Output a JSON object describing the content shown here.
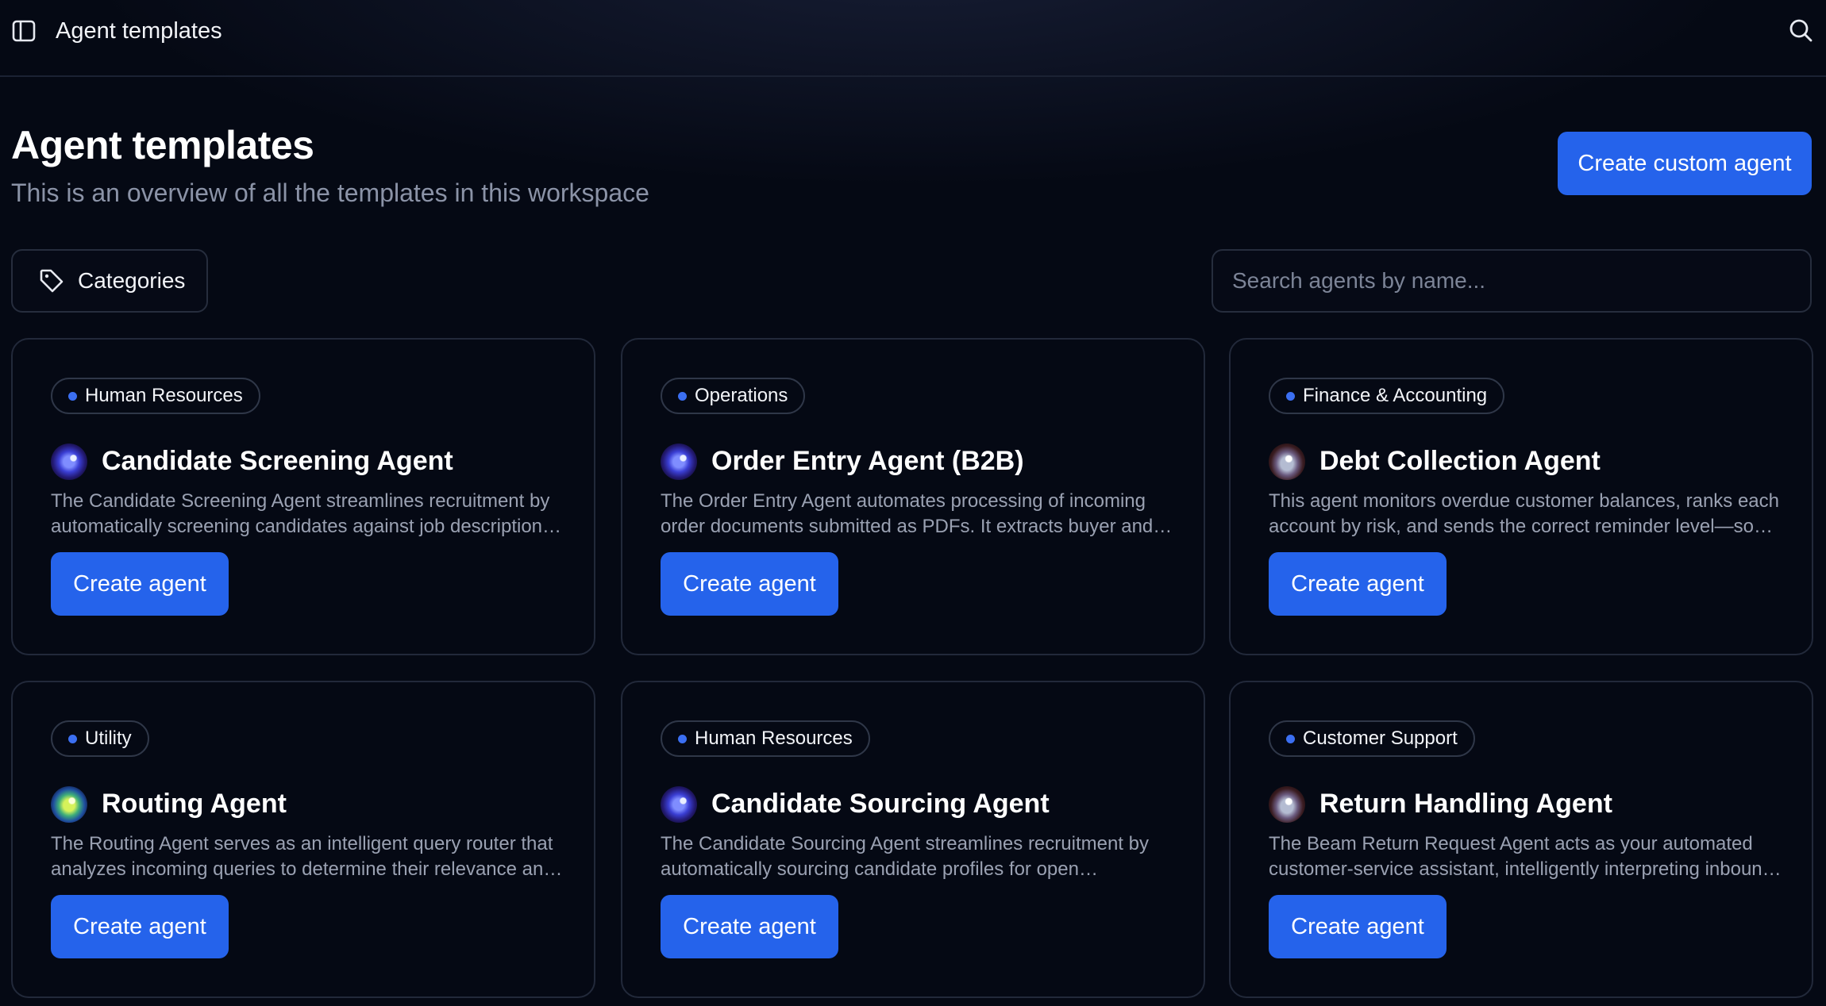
{
  "header": {
    "title": "Agent templates",
    "sidebar_toggle_icon": "sidebar-toggle-icon",
    "search_icon": "search-icon"
  },
  "page": {
    "title": "Agent templates",
    "subtitle": "This is an overview of all the templates in this workspace",
    "create_custom_label": "Create custom agent"
  },
  "filters": {
    "categories_label": "Categories",
    "categories_icon": "tag-icon",
    "search_placeholder": "Search agents by name..."
  },
  "colors": {
    "accent": "#2563eb",
    "background": "#050914",
    "pill_dot": "#3b6ff2"
  },
  "cards": [
    {
      "category": "Human Resources",
      "title": "Candidate Screening Agent",
      "description": "The Candidate Screening Agent streamlines recruitment by automatically screening candidates against job description…",
      "button": "Create agent",
      "icon": "blue-orb-icon"
    },
    {
      "category": "Operations",
      "title": "Order Entry Agent (B2B)",
      "description": "The Order Entry Agent automates processing of incoming order documents submitted as PDFs. It extracts buyer and…",
      "button": "Create agent",
      "icon": "blue-orb-icon"
    },
    {
      "category": "Finance & Accounting",
      "title": "Debt Collection Agent",
      "description": "This agent monitors overdue customer balances, ranks each account by risk, and sends the correct reminder level—so…",
      "button": "Create agent",
      "icon": "silver-orb-icon"
    },
    {
      "category": "Utility",
      "title": "Routing Agent",
      "description": "The Routing Agent serves as an intelligent query router that analyzes incoming queries to determine their relevance an…",
      "button": "Create agent",
      "icon": "lime-orb-icon"
    },
    {
      "category": "Human Resources",
      "title": "Candidate Sourcing Agent",
      "description": "The Candidate Sourcing Agent streamlines recruitment by automatically sourcing candidate profiles for open…",
      "button": "Create agent",
      "icon": "blue-orb-icon"
    },
    {
      "category": "Customer Support",
      "title": "Return Handling Agent",
      "description": "The Beam Return Request Agent acts as your automated customer-service assistant, intelligently interpreting inboun…",
      "button": "Create agent",
      "icon": "silver-orb-icon"
    }
  ]
}
